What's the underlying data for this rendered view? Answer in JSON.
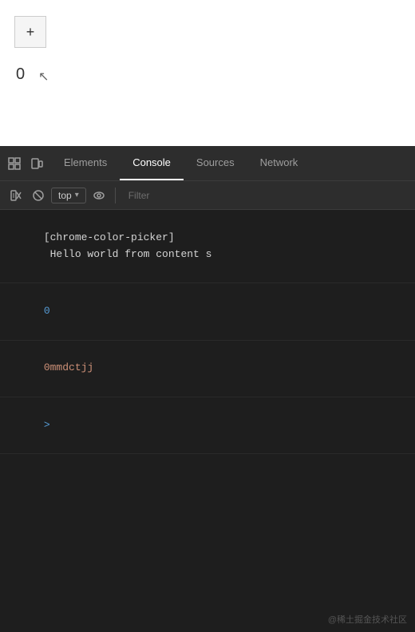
{
  "browser": {
    "plus_button_label": "+",
    "counter": "0"
  },
  "devtools": {
    "tabs": [
      {
        "id": "elements",
        "label": "Elements",
        "active": false
      },
      {
        "id": "console",
        "label": "Console",
        "active": true
      },
      {
        "id": "sources",
        "label": "Sources",
        "active": false
      },
      {
        "id": "network",
        "label": "Network",
        "active": false
      }
    ],
    "toolbar": {
      "context_label": "top",
      "filter_placeholder": "Filter"
    },
    "console_lines": [
      {
        "id": "line1",
        "type": "log-message",
        "text": "[chrome-color-picker] Hello world from content s"
      },
      {
        "id": "line2",
        "type": "log-number-blue",
        "text": "0"
      },
      {
        "id": "line3",
        "type": "log-string",
        "text": "0mmdctjj"
      },
      {
        "id": "line4",
        "type": "prompt",
        "text": ">"
      }
    ]
  },
  "watermark": {
    "text": "@稀土掘金技术社区"
  }
}
